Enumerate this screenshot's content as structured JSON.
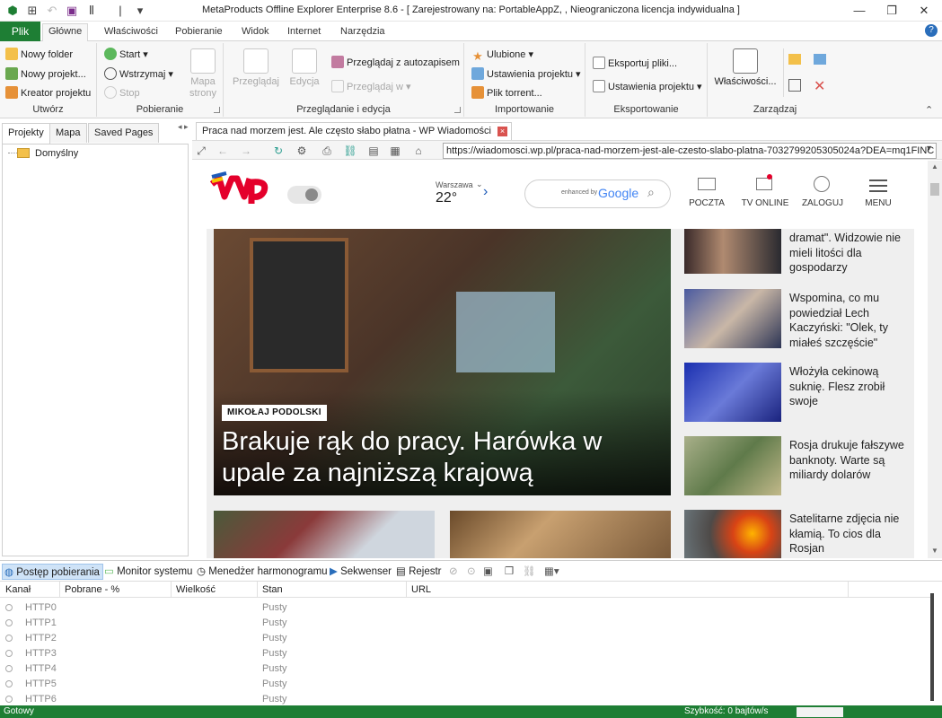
{
  "window": {
    "title": "MetaProducts Offline Explorer Enterprise 8.6 - [ Zarejestrowany na: PortableAppZ, , Nieograniczona licencja indywidualna ]"
  },
  "ribbon_tabs": {
    "plik": "Plik",
    "tabs": [
      "Główne",
      "Właściwości",
      "Pobieranie",
      "Widok",
      "Internet",
      "Narzędzia"
    ]
  },
  "ribbon": {
    "utwory": {
      "label": "Utwórz",
      "new_folder": "Nowy folder",
      "new_project": "Nowy projekt...",
      "wizard": "Kreator projektu"
    },
    "pobieranie": {
      "label": "Pobieranie",
      "start": "Start",
      "pause": "Wstrzymaj",
      "stop": "Stop",
      "map": "Mapa strony"
    },
    "przegladanie": {
      "label": "Przeglądanie i edycja",
      "browse": "Przeglądaj",
      "edit": "Edycja",
      "autosave": "Przeglądaj z autozapisem",
      "browse_in": "Przeglądaj w"
    },
    "importowanie": {
      "label": "Importowanie",
      "favorites": "Ulubione",
      "project_settings": "Ustawienia projektu",
      "torrent": "Plik torrent..."
    },
    "eksportowanie": {
      "label": "Eksportowanie",
      "export_files": "Eksportuj pliki...",
      "project_settings": "Ustawienia projektu"
    },
    "zarzadzaj": {
      "label": "Zarządzaj",
      "properties": "Właściwości..."
    }
  },
  "left_panel": {
    "tabs": [
      "Projekty",
      "Mapa",
      "Saved Pages"
    ],
    "tree": [
      "Domyślny"
    ]
  },
  "browser": {
    "tab_title": "Praca nad morzem jest. Ale często słabo płatna - WP Wiadomości",
    "url": "https://wiadomosci.wp.pl/praca-nad-morzem-jest-ale-czesto-slabo-platna-7032799205305024a?DEA=mq1FINC",
    "page": {
      "weather_city": "Warszawa",
      "weather_temp": "22°",
      "search_hint": "enhanced by",
      "google": "Google",
      "nav": [
        "POCZTA",
        "TV ONLINE",
        "ZALOGUJ",
        "MENU"
      ],
      "hero_tag": "MIKOŁAJ PODOLSKI",
      "hero_title": "Brakuje rąk do pracy. Harówka w upale za najniższą krajową",
      "side": [
        "dramat\". Widzowie nie mieli litości dla gospodarzy",
        "Wspomina, co mu powiedział Lech Kaczyński: \"Olek, ty miałeś szczęście\"",
        "Włożyła cekinową suknię. Flesz zrobił swoje",
        "Rosja drukuje fałszywe banknoty. Warte są miliardy dolarów",
        "Satelitarne zdjęcia nie kłamią. To cios dla Rosjan"
      ]
    }
  },
  "bottom": {
    "tabs": [
      "Postęp pobierania",
      "Monitor systemu",
      "Menedżer harmonogramu",
      "Sekwenser",
      "Rejestr"
    ],
    "columns": [
      "Kanał",
      "Pobrane - %",
      "Wielkość",
      "Stan",
      "URL"
    ],
    "rows": [
      {
        "ch": "HTTP0",
        "state": "Pusty"
      },
      {
        "ch": "HTTP1",
        "state": "Pusty"
      },
      {
        "ch": "HTTP2",
        "state": "Pusty"
      },
      {
        "ch": "HTTP3",
        "state": "Pusty"
      },
      {
        "ch": "HTTP4",
        "state": "Pusty"
      },
      {
        "ch": "HTTP5",
        "state": "Pusty"
      },
      {
        "ch": "HTTP6",
        "state": "Pusty"
      }
    ]
  },
  "status": {
    "left": "Gotowy",
    "speed": "Szybkość: 0 bajtów/s"
  },
  "colors": {
    "accent": "#1e7e34",
    "wp_red": "#e4002b"
  }
}
